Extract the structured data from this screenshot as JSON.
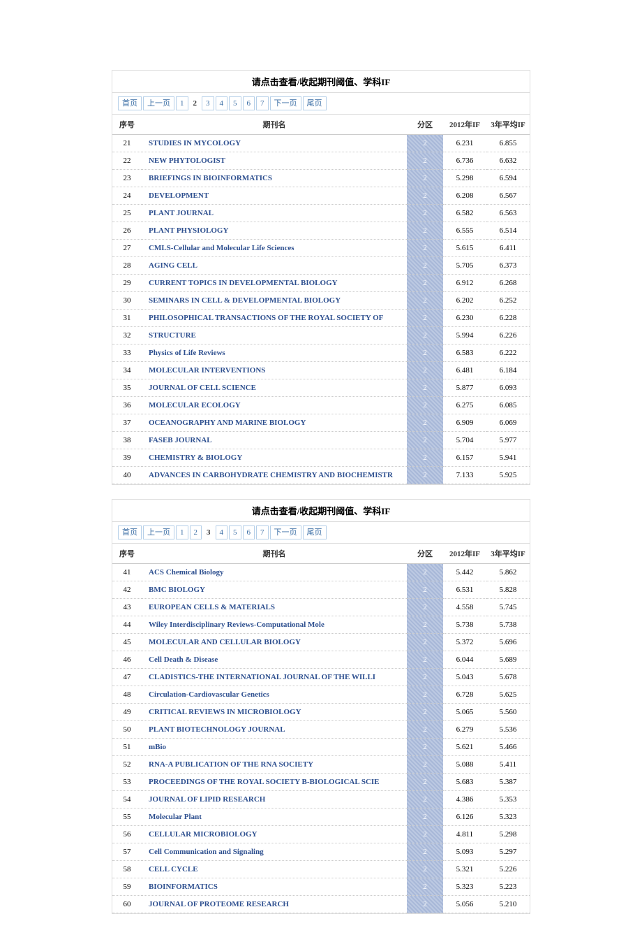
{
  "title": "请点击查看/收起期刊阈值、学科IF",
  "pager": {
    "first": "首页",
    "prev": "上一页",
    "next": "下一页",
    "last": "尾页",
    "pages": [
      "1",
      "2",
      "3",
      "4",
      "5",
      "6",
      "7"
    ]
  },
  "headers": {
    "idx": "序号",
    "name": "期刊名",
    "zone": "分区",
    "if": "2012年IF",
    "if3": "3年平均IF"
  },
  "tables": [
    {
      "current_page": "2",
      "rows": [
        {
          "idx": "21",
          "name": "STUDIES IN MYCOLOGY",
          "zone": "2",
          "if": "6.231",
          "if3": "6.855"
        },
        {
          "idx": "22",
          "name": "NEW PHYTOLOGIST",
          "zone": "2",
          "if": "6.736",
          "if3": "6.632"
        },
        {
          "idx": "23",
          "name": "BRIEFINGS IN BIOINFORMATICS",
          "zone": "2",
          "if": "5.298",
          "if3": "6.594"
        },
        {
          "idx": "24",
          "name": "DEVELOPMENT",
          "zone": "2",
          "if": "6.208",
          "if3": "6.567"
        },
        {
          "idx": "25",
          "name": "PLANT JOURNAL",
          "zone": "2",
          "if": "6.582",
          "if3": "6.563"
        },
        {
          "idx": "26",
          "name": "PLANT PHYSIOLOGY",
          "zone": "2",
          "if": "6.555",
          "if3": "6.514"
        },
        {
          "idx": "27",
          "name": "CMLS-Cellular and Molecular Life Sciences",
          "zone": "2",
          "if": "5.615",
          "if3": "6.411"
        },
        {
          "idx": "28",
          "name": "AGING CELL",
          "zone": "2",
          "if": "5.705",
          "if3": "6.373"
        },
        {
          "idx": "29",
          "name": "CURRENT TOPICS IN DEVELOPMENTAL BIOLOGY",
          "zone": "2",
          "if": "6.912",
          "if3": "6.268"
        },
        {
          "idx": "30",
          "name": "SEMINARS IN CELL & DEVELOPMENTAL BIOLOGY",
          "zone": "2",
          "if": "6.202",
          "if3": "6.252"
        },
        {
          "idx": "31",
          "name": "PHILOSOPHICAL TRANSACTIONS OF THE ROYAL SOCIETY OF",
          "zone": "2",
          "if": "6.230",
          "if3": "6.228"
        },
        {
          "idx": "32",
          "name": "STRUCTURE",
          "zone": "2",
          "if": "5.994",
          "if3": "6.226"
        },
        {
          "idx": "33",
          "name": "Physics of Life Reviews",
          "zone": "2",
          "if": "6.583",
          "if3": "6.222"
        },
        {
          "idx": "34",
          "name": "MOLECULAR INTERVENTIONS",
          "zone": "2",
          "if": "6.481",
          "if3": "6.184"
        },
        {
          "idx": "35",
          "name": "JOURNAL OF CELL SCIENCE",
          "zone": "2",
          "if": "5.877",
          "if3": "6.093"
        },
        {
          "idx": "36",
          "name": "MOLECULAR ECOLOGY",
          "zone": "2",
          "if": "6.275",
          "if3": "6.085"
        },
        {
          "idx": "37",
          "name": "OCEANOGRAPHY AND MARINE BIOLOGY",
          "zone": "2",
          "if": "6.909",
          "if3": "6.069"
        },
        {
          "idx": "38",
          "name": "FASEB JOURNAL",
          "zone": "2",
          "if": "5.704",
          "if3": "5.977"
        },
        {
          "idx": "39",
          "name": "CHEMISTRY & BIOLOGY",
          "zone": "2",
          "if": "6.157",
          "if3": "5.941"
        },
        {
          "idx": "40",
          "name": "ADVANCES IN CARBOHYDRATE CHEMISTRY AND BIOCHEMISTR",
          "zone": "2",
          "if": "7.133",
          "if3": "5.925"
        }
      ]
    },
    {
      "current_page": "3",
      "rows": [
        {
          "idx": "41",
          "name": "ACS Chemical Biology",
          "zone": "2",
          "if": "5.442",
          "if3": "5.862"
        },
        {
          "idx": "42",
          "name": "BMC BIOLOGY",
          "zone": "2",
          "if": "6.531",
          "if3": "5.828"
        },
        {
          "idx": "43",
          "name": "EUROPEAN CELLS & MATERIALS",
          "zone": "2",
          "if": "4.558",
          "if3": "5.745"
        },
        {
          "idx": "44",
          "name": "Wiley Interdisciplinary Reviews-Computational Mole",
          "zone": "2",
          "if": "5.738",
          "if3": "5.738"
        },
        {
          "idx": "45",
          "name": "MOLECULAR AND CELLULAR BIOLOGY",
          "zone": "2",
          "if": "5.372",
          "if3": "5.696"
        },
        {
          "idx": "46",
          "name": "Cell Death & Disease",
          "zone": "2",
          "if": "6.044",
          "if3": "5.689"
        },
        {
          "idx": "47",
          "name": "CLADISTICS-THE INTERNATIONAL JOURNAL OF THE WILLI",
          "zone": "2",
          "if": "5.043",
          "if3": "5.678"
        },
        {
          "idx": "48",
          "name": "Circulation-Cardiovascular Genetics",
          "zone": "2",
          "if": "6.728",
          "if3": "5.625"
        },
        {
          "idx": "49",
          "name": "CRITICAL REVIEWS IN MICROBIOLOGY",
          "zone": "2",
          "if": "5.065",
          "if3": "5.560"
        },
        {
          "idx": "50",
          "name": "PLANT BIOTECHNOLOGY JOURNAL",
          "zone": "2",
          "if": "6.279",
          "if3": "5.536"
        },
        {
          "idx": "51",
          "name": "mBio",
          "zone": "2",
          "if": "5.621",
          "if3": "5.466"
        },
        {
          "idx": "52",
          "name": "RNA-A PUBLICATION OF THE RNA SOCIETY",
          "zone": "2",
          "if": "5.088",
          "if3": "5.411"
        },
        {
          "idx": "53",
          "name": "PROCEEDINGS OF THE ROYAL SOCIETY B-BIOLOGICAL SCIE",
          "zone": "2",
          "if": "5.683",
          "if3": "5.387"
        },
        {
          "idx": "54",
          "name": "JOURNAL OF LIPID RESEARCH",
          "zone": "2",
          "if": "4.386",
          "if3": "5.353"
        },
        {
          "idx": "55",
          "name": "Molecular Plant",
          "zone": "2",
          "if": "6.126",
          "if3": "5.323"
        },
        {
          "idx": "56",
          "name": "CELLULAR MICROBIOLOGY",
          "zone": "2",
          "if": "4.811",
          "if3": "5.298"
        },
        {
          "idx": "57",
          "name": "Cell Communication and Signaling",
          "zone": "2",
          "if": "5.093",
          "if3": "5.297"
        },
        {
          "idx": "58",
          "name": "CELL CYCLE",
          "zone": "2",
          "if": "5.321",
          "if3": "5.226"
        },
        {
          "idx": "59",
          "name": "BIOINFORMATICS",
          "zone": "2",
          "if": "5.323",
          "if3": "5.223"
        },
        {
          "idx": "60",
          "name": "JOURNAL OF PROTEOME RESEARCH",
          "zone": "2",
          "if": "5.056",
          "if3": "5.210"
        }
      ]
    }
  ]
}
